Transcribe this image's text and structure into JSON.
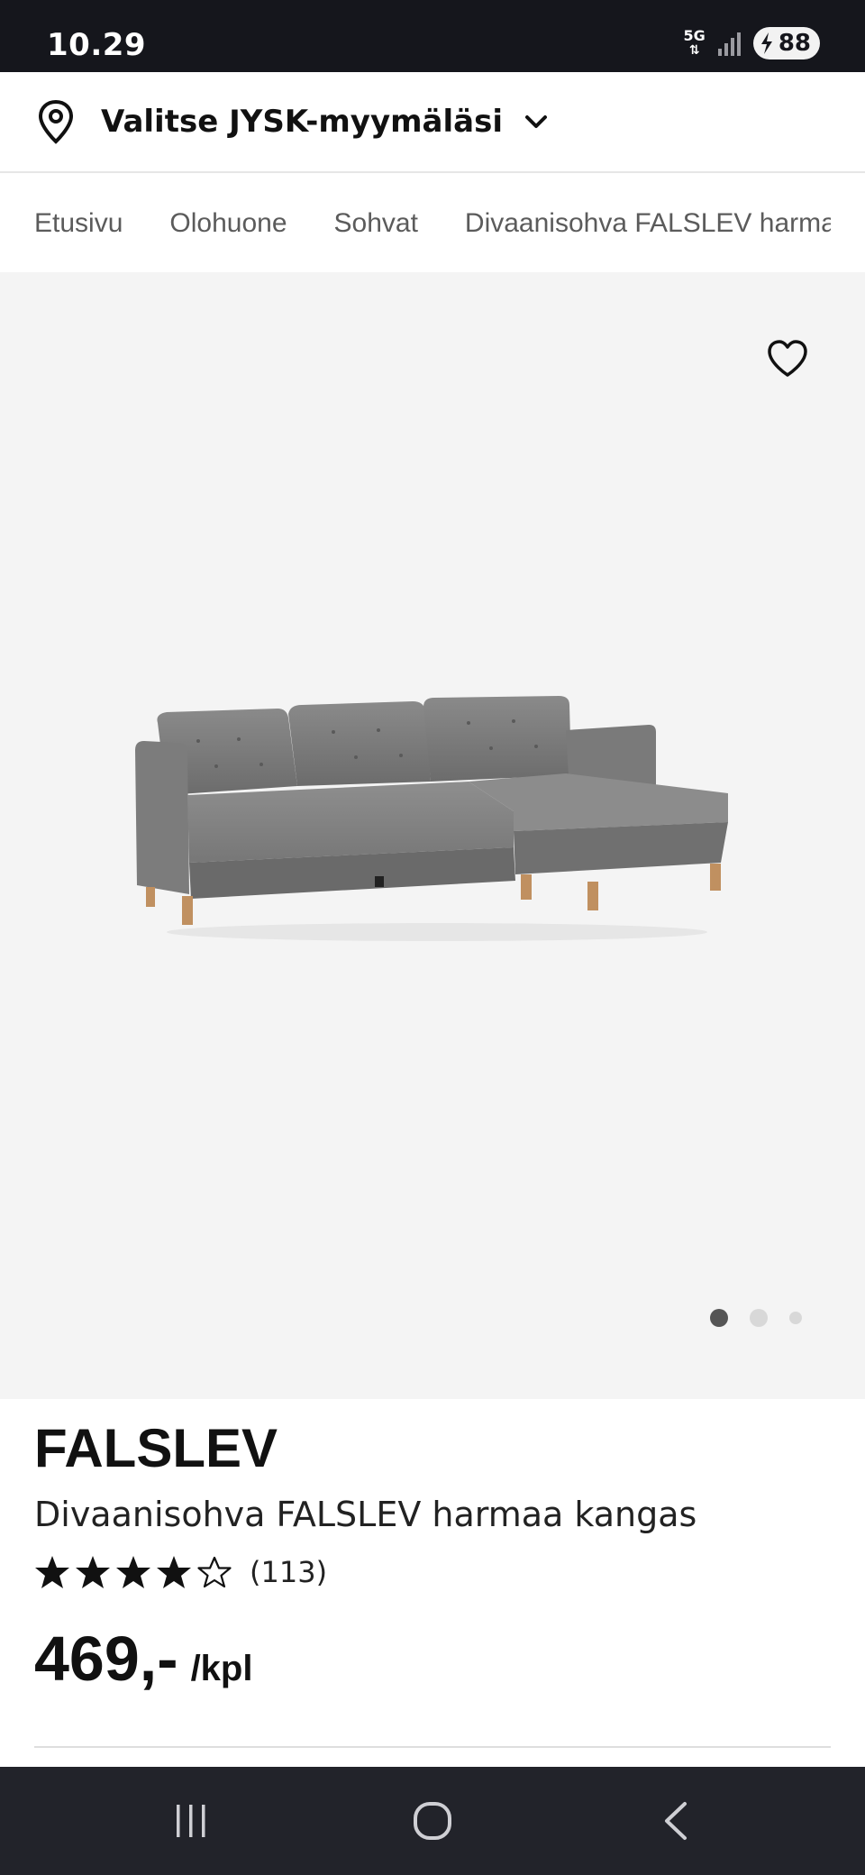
{
  "status_bar": {
    "time": "10.29",
    "network": "5G",
    "battery": "88",
    "icons": [
      "network-5g-icon",
      "signal-icon",
      "battery-charging-icon"
    ]
  },
  "store_selector": {
    "label": "Valitse JYSK-myymäläsi",
    "icon": "location-pin-icon"
  },
  "breadcrumb": {
    "items": [
      "Etusivu",
      "Olohuone",
      "Sohvat",
      "Divaanisohva FALSLEV harmaa kangas"
    ]
  },
  "gallery": {
    "image_subject": "sofa-image",
    "current_index": 1,
    "total": 3
  },
  "product": {
    "brand": "FALSLEV",
    "name": "Divaanisohva FALSLEV harmaa kangas",
    "rating": 4,
    "rating_max": 5,
    "review_count": "(113)",
    "price": "469,-",
    "price_unit": "/kpl"
  },
  "nav": {
    "buttons": [
      "recent-apps-icon",
      "home-icon",
      "back-icon"
    ]
  },
  "colors": {
    "status_bg": "#15161c",
    "nav_bg": "#22232a",
    "gallery_bg": "#f4f4f4",
    "text": "#111111"
  }
}
